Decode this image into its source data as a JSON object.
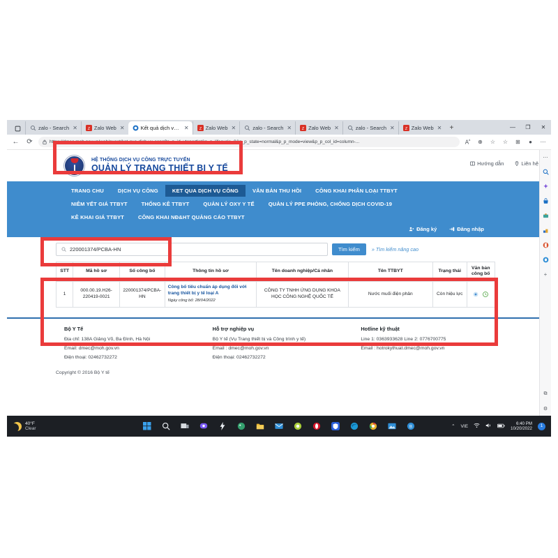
{
  "browser": {
    "tabs": [
      {
        "label": "zalo - Search",
        "favicon": "search-icon",
        "active": false
      },
      {
        "label": "Zalo Web",
        "favicon": "zalo-icon",
        "active": false
      },
      {
        "label": "Kết quả dịch vụ c",
        "favicon": "globe-icon",
        "active": true
      },
      {
        "label": "Zalo Web",
        "favicon": "zalo-icon",
        "active": false
      },
      {
        "label": "zalo - Search",
        "favicon": "search-icon",
        "active": false
      },
      {
        "label": "Zalo Web",
        "favicon": "zalo-icon",
        "active": false
      },
      {
        "label": "zalo - Search",
        "favicon": "search-icon",
        "active": false
      },
      {
        "label": "Zalo Web",
        "favicon": "zalo-icon",
        "active": false
      }
    ],
    "tab_close_glyph": "✕",
    "new_tab_glyph": "+",
    "window_controls": {
      "minimize": "—",
      "maximize": "❐",
      "close": "✕"
    },
    "back_glyph": "←",
    "reload_glyph": "⟳",
    "lock_glyph": "🔒",
    "url": "https://dmec.moh.gov.vn/web/guest/ket-qua-dich-vu-cong?p_p_id=yteportlet&p_p_lifecycle=0&p_p_state=normal&p_p_mode=view&p_p_col_id=column-...",
    "url_visible": "yteportlet&p_p_lifecycle=0&p_p_state=normal&p_p_mode=view&p_p_col_id=column-...",
    "toolbar_icons": [
      "read-aloud-icon",
      "zoom-icon",
      "collections-favorites-icon",
      "favorite-star-icon",
      "collections-icon",
      "profile-icon",
      "settings-more-icon"
    ]
  },
  "site": {
    "logo": {
      "line1": "HỆ THỐNG DỊCH VỤ CÔNG TRỰC TUYẾN",
      "line2": "QUẢN LÝ TRANG THIẾT BỊ Y TẾ",
      "emblem": "ministry-of-health-emblem"
    },
    "header_links": [
      {
        "label": "Hướng dẫn",
        "icon": "book-icon"
      },
      {
        "label": "Liên hệ",
        "icon": "location-pin-icon"
      }
    ],
    "nav_rows": [
      [
        {
          "label": "TRANG CHU",
          "active": false
        },
        {
          "label": "DỊCH VỤ CÔNG",
          "active": false
        },
        {
          "label": "KET QUA DỊCH VỤ CÔNG",
          "active": true
        },
        {
          "label": "VĂN BẢN THU HỒI",
          "active": false
        },
        {
          "label": "CÔNG KHAI PHÂN LOẠI TTBYT",
          "active": false
        }
      ],
      [
        {
          "label": "NIÊM YẾT GIÁ TTBYT",
          "active": false
        },
        {
          "label": "THỐNG KÊ TTBYT",
          "active": false
        },
        {
          "label": "QUẢN LÝ OXY Y TẾ",
          "active": false
        },
        {
          "label": "QUẢN LÝ PPE PHÒNG, CHỐNG DỊCH COVID-19",
          "active": false
        }
      ],
      [
        {
          "label": "KÊ KHAI GIÁ TTBYT",
          "active": false
        },
        {
          "label": "CÔNG KHAI NĐ&HT QUẢNG CÁO TTBYT",
          "active": false
        }
      ]
    ],
    "auth": [
      {
        "label": "Đăng ký",
        "icon": "user-add-icon"
      },
      {
        "label": "Đăng nhập",
        "icon": "login-icon"
      }
    ],
    "search": {
      "value": "220001374/PCBA-HN",
      "placeholder": "",
      "icon": "search-icon",
      "button_label": "Tìm kiếm",
      "advanced_label": "Tìm kiếm nâng cao",
      "advanced_prefix": "»"
    },
    "table": {
      "headers": [
        "STT",
        "Mã hồ sơ",
        "Số công bố",
        "Thông tin hồ sơ",
        "Tên doanh nghiệp/Cá nhân",
        "Tên TTBYT",
        "Trạng thái",
        "Văn bản công bố"
      ],
      "rows": [
        {
          "stt": "1",
          "ma_ho_so": "000.00.19.H26-220419-0021",
          "so_cong_bo": "220001374/PCBA-HN",
          "thong_tin_title": "Công bố tiêu chuẩn áp dụng đối với trang thiết bị y tế loại A",
          "thong_tin_date": "Ngày công bố: 28/04/2022",
          "ten_doanh_nghiep": "CÔNG TY TNHH ỨNG DỤNG KHOA HỌC CÔNG NGHỆ QUỐC TẾ",
          "ten_ttbyt": "Nước muối điện phân",
          "trang_thai": "Còn hiệu lực",
          "van_ban_icons": [
            "download-document-icon",
            "view-certificate-icon"
          ]
        }
      ]
    },
    "footer": {
      "columns": [
        {
          "title": "Bộ Y Tế",
          "lines": [
            "Địa chỉ: 138A Giảng Võ, Ba Đình, Hà Nội",
            "Email: dmec@moh.gov.vn",
            "Điện thoại: 02462732272"
          ]
        },
        {
          "title": "Hỗ trợ nghiệp vụ",
          "lines": [
            "Bộ Y tế (Vụ Trang thiết bị và Công trình y tế)",
            "Email : dmec@moh.gov.vn",
            "Điện thoại: 02462732272"
          ]
        },
        {
          "title": "Hotline kỹ thuật",
          "lines": [
            "Line 1: 0363933628 Line 2: 0776700775",
            "Email : hotrokythuat.dmec@moh.gov.vn",
            ""
          ]
        }
      ],
      "copyright": "Copyright © 2016 Bộ Y tế"
    }
  },
  "taskbar": {
    "weather_temp": "40°F",
    "weather_desc": "Clear",
    "weather_icon": "moon-icon",
    "icons": [
      "start-windows-icon",
      "search-icon",
      "task-view-icon",
      "teams-chat-icon",
      "lightning-icon",
      "paint-icon",
      "file-explorer-icon",
      "mail-icon",
      "unikey-icon",
      "opera-icon",
      "brave-icon",
      "edge-icon",
      "chrome-icon",
      "photos-icon",
      "zalo-icon"
    ],
    "tray": {
      "chevron": "⌃",
      "language": "VIE",
      "wifi_icon": "wifi-icon",
      "volume_icon": "volume-icon",
      "battery_icon": "battery-icon",
      "time": "6:40 PM",
      "date": "10/20/2022",
      "notification_badge": "1"
    }
  },
  "annotations": {
    "colors": {
      "highlight": "#ea3b3b",
      "nav_blue": "#3f8ccd",
      "nav_active": "#1d5a94",
      "logo_blue": "#16489c"
    },
    "boxes": [
      "logo-highlight",
      "search-highlight",
      "results-table-highlight"
    ]
  }
}
